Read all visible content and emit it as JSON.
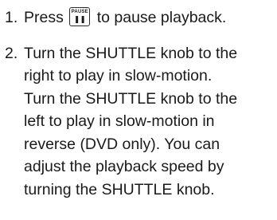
{
  "steps": [
    {
      "number": "1.",
      "lines": [
        {
          "before_key": "Press",
          "key_label": "PAUSE",
          "key_icon": "pause-icon",
          "key_glyph": "❚❚",
          "after_key": "to pause playback."
        }
      ]
    },
    {
      "number": "2.",
      "lines": [
        "Turn the SHUTTLE knob to the",
        "right to play in slow-motion.",
        "Turn the SHUTTLE knob to the",
        "left to play in slow-motion in",
        "reverse (DVD only). You can",
        "adjust the playback speed by",
        "turning the SHUTTLE knob."
      ]
    }
  ]
}
